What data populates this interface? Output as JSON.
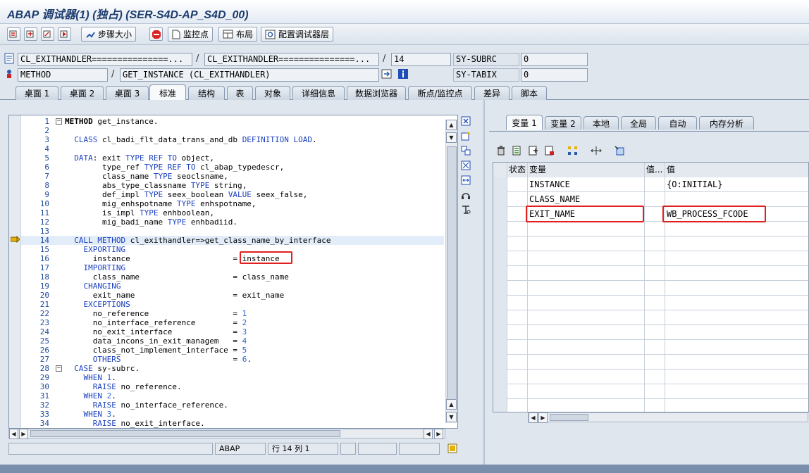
{
  "window": {
    "title": "ABAP 调试器(1)  (独占) (SER-S4D-AP_S4D_00)"
  },
  "toolbar": {
    "step_size": "步骤大小",
    "breakpoint": "监控点",
    "layout": "布局",
    "config_layers": "配置调试器层"
  },
  "header": {
    "program1": "CL_EXITHANDLER===============...",
    "program2": "CL_EXITHANDLER===============...",
    "line": "14",
    "subrc_label": "SY-SUBRC",
    "subrc_value": "0",
    "event_type": "METHOD",
    "event_name": "GET_INSTANCE (CL_EXITHANDLER)",
    "tabix_label": "SY-TABIX",
    "tabix_value": "0"
  },
  "tabs": [
    "桌面 1",
    "桌面 2",
    "桌面 3",
    "标准",
    "结构",
    "表",
    "对象",
    "详细信息",
    "数据浏览器",
    "断点/监控点",
    "差异",
    "脚本"
  ],
  "active_tab": "标准",
  "code": [
    "METHOD get_instance.",
    "",
    "  CLASS cl_badi_flt_data_trans_and_db DEFINITION LOAD.",
    "",
    "  DATA: exit TYPE REF TO object,",
    "        type_ref TYPE REF TO cl_abap_typedescr,",
    "        class_name TYPE seoclsname,",
    "        abs_type_classname TYPE string,",
    "        def_impl TYPE seex_boolean VALUE seex_false,",
    "        mig_enhspotname TYPE enhspotname,",
    "        is_impl TYPE enhboolean,",
    "        mig_badi_name TYPE enhbadiid.",
    "",
    "  CALL METHOD cl_exithandler=>get_class_name_by_interface",
    "    EXPORTING",
    "      instance                      = instance",
    "    IMPORTING",
    "      class_name                    = class_name",
    "    CHANGING",
    "      exit_name                     = exit_name",
    "    EXCEPTIONS",
    "      no_reference                  = 1",
    "      no_interface_reference        = 2",
    "      no_exit_interface             = 3",
    "      data_incons_in_exit_managem   = 4",
    "      class_not_implement_interface = 5",
    "      OTHERS                        = 6.",
    "  CASE sy-subrc.",
    "    WHEN 1.",
    "      RAISE no_reference.",
    "    WHEN 2.",
    "      RAISE no_interface_reference.",
    "    WHEN 3.",
    "      RAISE no_exit_interface."
  ],
  "status": {
    "language": "ABAP",
    "position": "行 14 列  1"
  },
  "right_tabs": [
    "变量 1",
    "变量 2",
    "本地",
    "全局",
    "自动",
    "内存分析"
  ],
  "right_active_tab": "变量 1",
  "var_table": {
    "headers": [
      "状态",
      "变量",
      "值...",
      "值"
    ],
    "rows": [
      {
        "name": "INSTANCE",
        "value": "{O:INITIAL}"
      },
      {
        "name": "CLASS_NAME",
        "value": ""
      },
      {
        "name": "EXIT_NAME",
        "value": "WB_PROCESS_FCODE"
      }
    ]
  }
}
